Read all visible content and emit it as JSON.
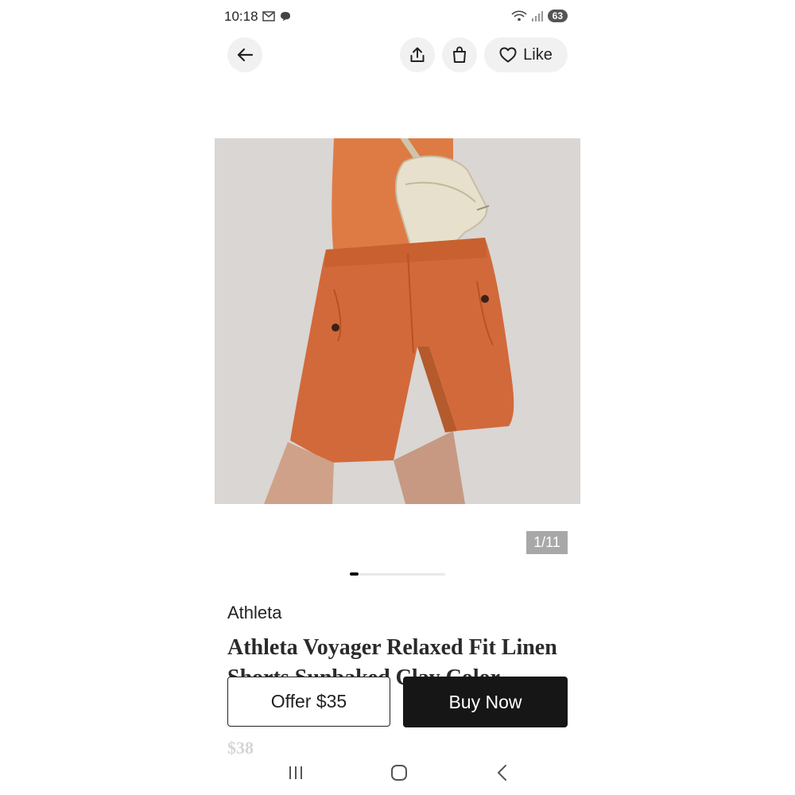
{
  "status_bar": {
    "time": "10:18",
    "left_icons": [
      "gmail-icon",
      "chat-bubble-icon"
    ],
    "right_icons": [
      "wifi-icon",
      "signal-icon"
    ],
    "battery_level": "63"
  },
  "top_bar": {
    "back_icon": "arrow-left-icon",
    "share_icon": "share-icon",
    "bag_icon": "shopping-bag-icon",
    "like_icon": "heart-outline-icon",
    "like_label": "Like"
  },
  "product": {
    "image_alt_desc": "orange-linen-shorts-photo",
    "image_counter": "1/11",
    "carousel_position": 0.09,
    "brand": "Athleta",
    "title": "Athleta Voyager Relaxed Fit Linen Shorts Sunbaked Clay Color",
    "price_partial": "$38"
  },
  "actions": {
    "offer_label": "Offer $35",
    "buy_label": "Buy Now"
  },
  "nav": {
    "recents_icon": "recents-icon",
    "home_icon": "home-icon",
    "back_icon": "back-chevron-icon"
  },
  "colors": {
    "shorts": "#d2693a",
    "top": "#de7b45",
    "background_photo": "#d9d6d3",
    "buy_button": "#161616"
  }
}
